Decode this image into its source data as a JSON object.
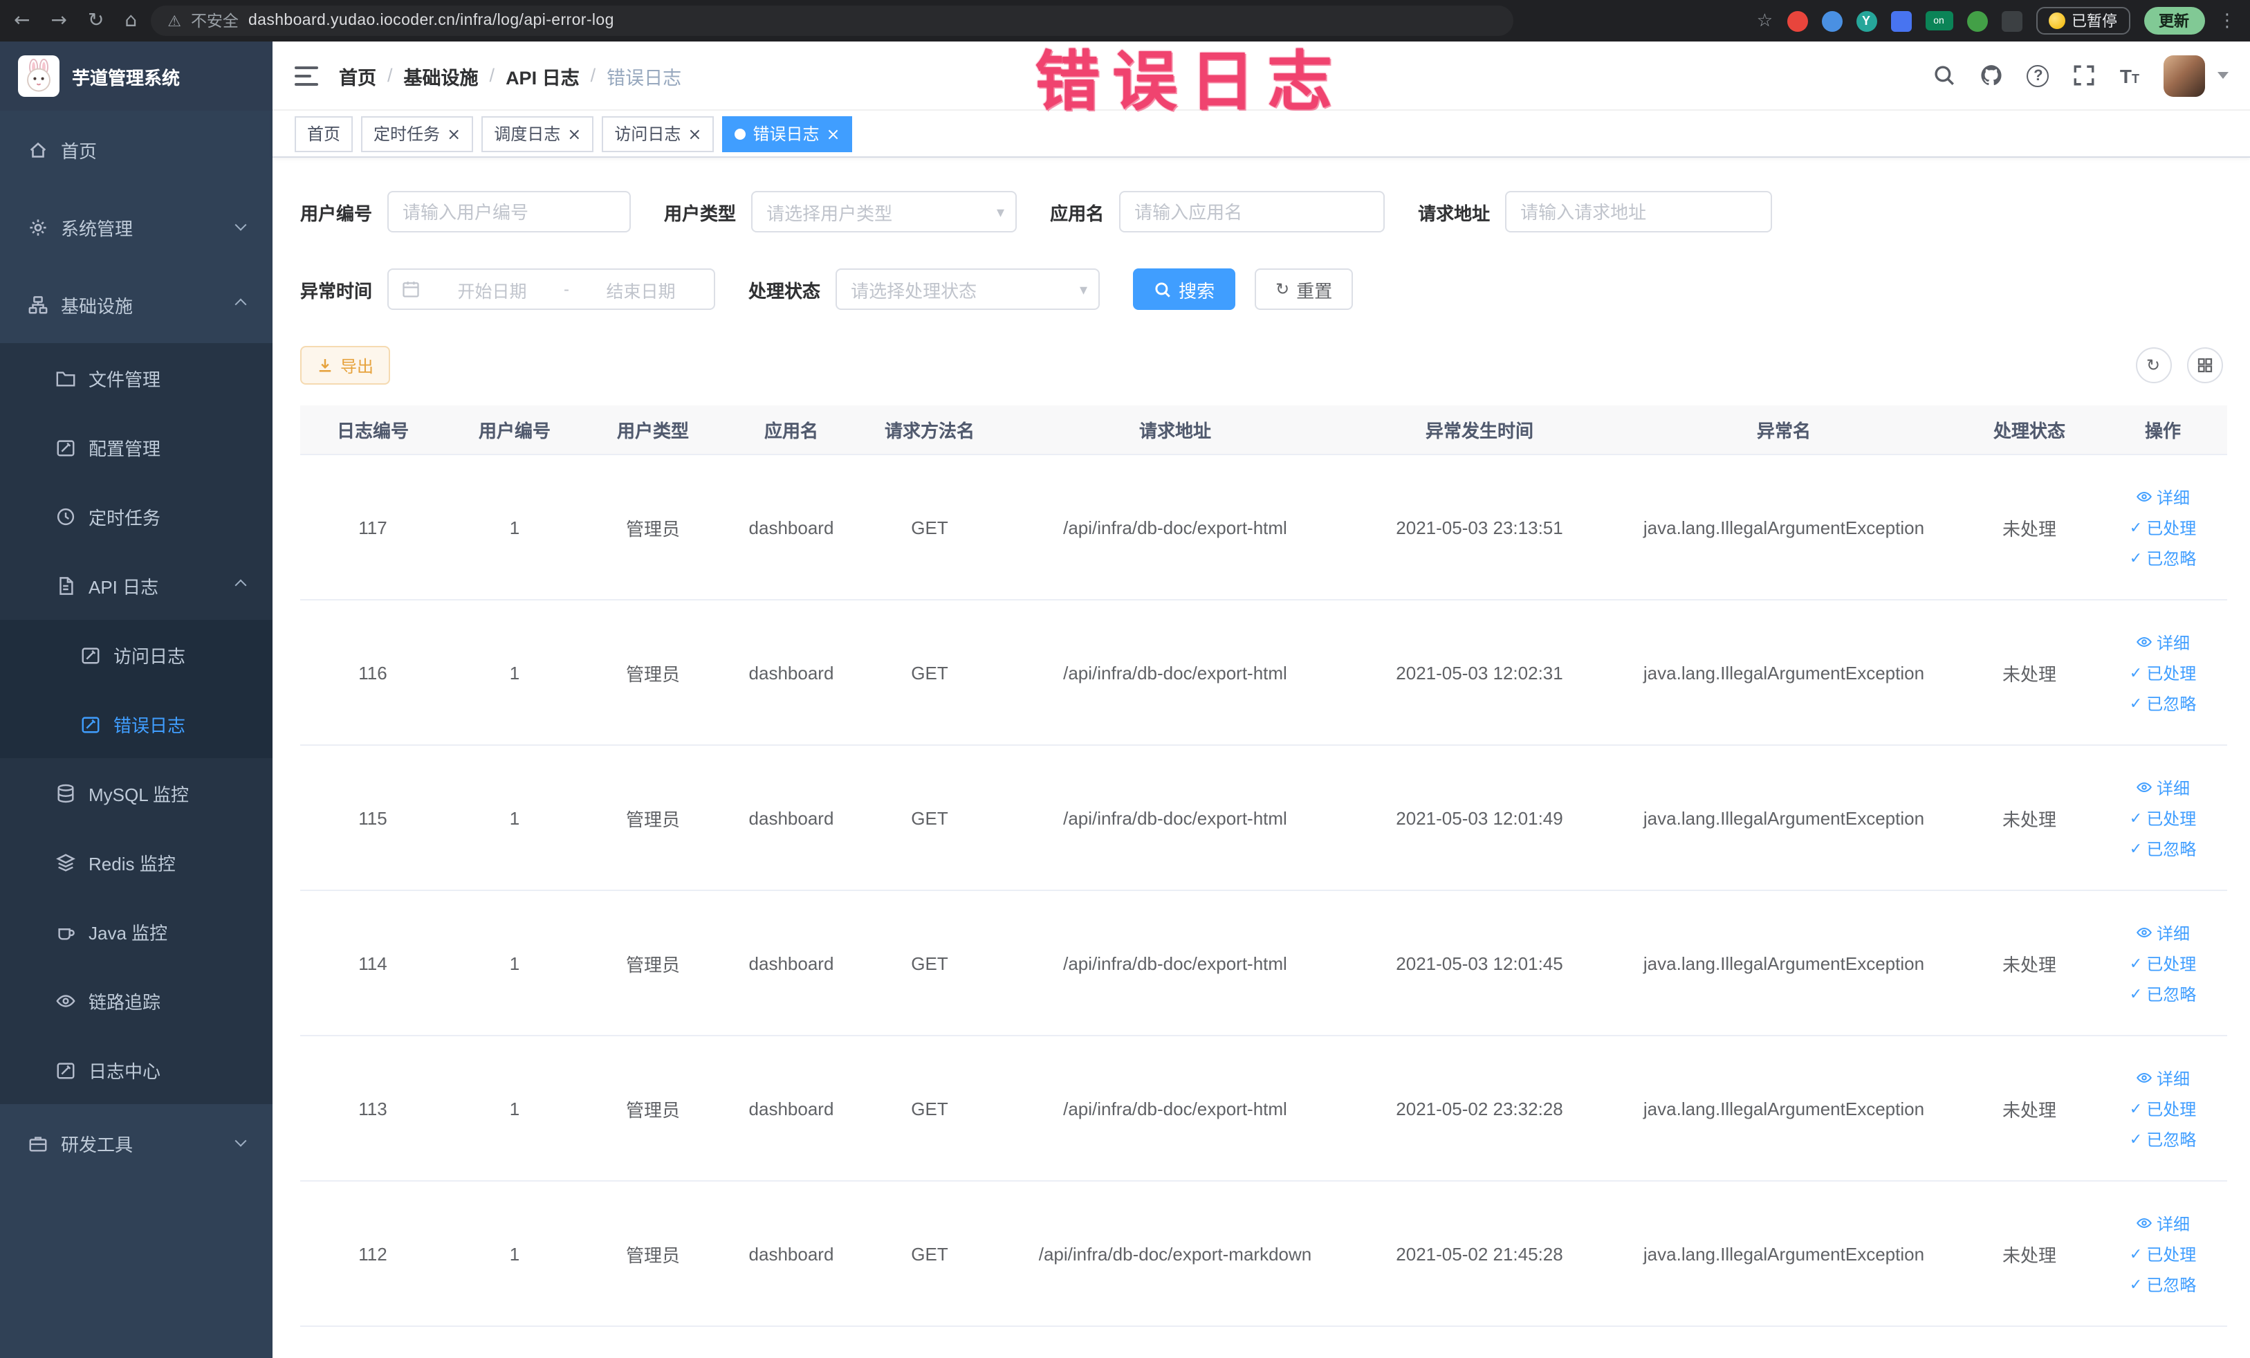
{
  "browser": {
    "security_label": "不安全",
    "url": "dashboard.yudao.iocoder.cn/infra/log/api-error-log",
    "paused_badge": "已暂停",
    "update_button": "更新"
  },
  "annotation": {
    "text": "错误日志"
  },
  "sidebar": {
    "logo_title": "芋道管理系统",
    "items": [
      {
        "label": "首页"
      },
      {
        "label": "系统管理"
      },
      {
        "label": "基础设施"
      },
      {
        "label": "文件管理"
      },
      {
        "label": "配置管理"
      },
      {
        "label": "定时任务"
      },
      {
        "label": "API 日志"
      },
      {
        "label": "访问日志"
      },
      {
        "label": "错误日志"
      },
      {
        "label": "MySQL 监控"
      },
      {
        "label": "Redis 监控"
      },
      {
        "label": "Java 监控"
      },
      {
        "label": "链路追踪"
      },
      {
        "label": "日志中心"
      },
      {
        "label": "研发工具"
      }
    ]
  },
  "breadcrumb": {
    "separator": "/",
    "items": [
      "首页",
      "基础设施",
      "API 日志",
      "错误日志"
    ]
  },
  "tabs": [
    {
      "label": "首页"
    },
    {
      "label": "定时任务"
    },
    {
      "label": "调度日志"
    },
    {
      "label": "访问日志"
    },
    {
      "label": "错误日志"
    }
  ],
  "filters": {
    "user_id": {
      "label": "用户编号",
      "placeholder": "请输入用户编号"
    },
    "user_type": {
      "label": "用户类型",
      "placeholder": "请选择用户类型"
    },
    "app_name": {
      "label": "应用名",
      "placeholder": "请输入应用名"
    },
    "request_url": {
      "label": "请求地址",
      "placeholder": "请输入请求地址"
    },
    "exception_time": {
      "label": "异常时间",
      "start_placeholder": "开始日期",
      "separator": "-",
      "end_placeholder": "结束日期"
    },
    "process_status": {
      "label": "处理状态",
      "placeholder": "请选择处理状态"
    },
    "search_button": "搜索",
    "reset_button": "重置"
  },
  "toolbar": {
    "export_button": "导出"
  },
  "table": {
    "columns": [
      "日志编号",
      "用户编号",
      "用户类型",
      "应用名",
      "请求方法名",
      "请求地址",
      "异常发生时间",
      "异常名",
      "处理状态",
      "操作"
    ],
    "actions": {
      "detail": "详细",
      "processed": "已处理",
      "ignored": "已忽略"
    },
    "rows": [
      {
        "id": "117",
        "user_id": "1",
        "user_type": "管理员",
        "app": "dashboard",
        "method": "GET",
        "url": "/api/infra/db-doc/export-html",
        "time": "2021-05-03 23:13:51",
        "exception": "java.lang.IllegalArgumentException",
        "status": "未处理"
      },
      {
        "id": "116",
        "user_id": "1",
        "user_type": "管理员",
        "app": "dashboard",
        "method": "GET",
        "url": "/api/infra/db-doc/export-html",
        "time": "2021-05-03 12:02:31",
        "exception": "java.lang.IllegalArgumentException",
        "status": "未处理"
      },
      {
        "id": "115",
        "user_id": "1",
        "user_type": "管理员",
        "app": "dashboard",
        "method": "GET",
        "url": "/api/infra/db-doc/export-html",
        "time": "2021-05-03 12:01:49",
        "exception": "java.lang.IllegalArgumentException",
        "status": "未处理"
      },
      {
        "id": "114",
        "user_id": "1",
        "user_type": "管理员",
        "app": "dashboard",
        "method": "GET",
        "url": "/api/infra/db-doc/export-html",
        "time": "2021-05-03 12:01:45",
        "exception": "java.lang.IllegalArgumentException",
        "status": "未处理"
      },
      {
        "id": "113",
        "user_id": "1",
        "user_type": "管理员",
        "app": "dashboard",
        "method": "GET",
        "url": "/api/infra/db-doc/export-html",
        "time": "2021-05-02 23:32:28",
        "exception": "java.lang.IllegalArgumentException",
        "status": "未处理"
      },
      {
        "id": "112",
        "user_id": "1",
        "user_type": "管理员",
        "app": "dashboard",
        "method": "GET",
        "url": "/api/infra/db-doc/export-markdown",
        "time": "2021-05-02 21:45:28",
        "exception": "java.lang.IllegalArgumentException",
        "status": "未处理"
      }
    ]
  },
  "glyphs": {
    "back": "←",
    "forward": "→",
    "reload": "↻",
    "home": "⌂",
    "warning": "⚠",
    "star": "☆",
    "more": "⋮",
    "close": "×",
    "check": "✓",
    "caret_down": "▾",
    "question": "?"
  }
}
